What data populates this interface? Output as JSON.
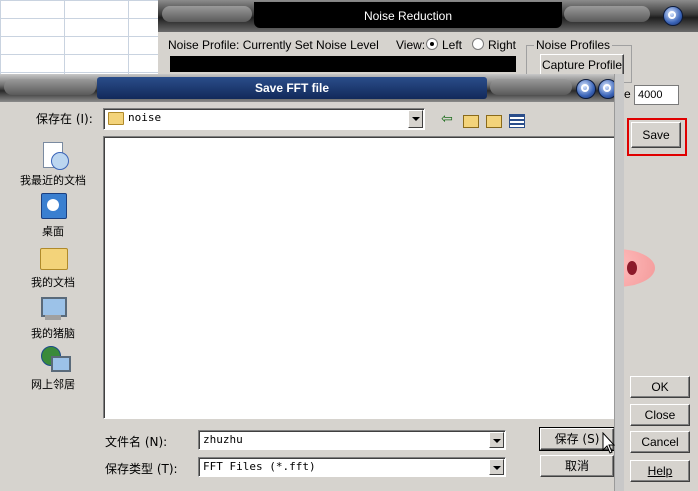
{
  "noise_window": {
    "title": "Noise Reduction",
    "profile_label": "Noise Profile: Currently Set Noise Level",
    "view_label": "View:",
    "view_left": "Left",
    "view_right": "Right",
    "view_selected": "Left",
    "profiles_group": "Noise Profiles",
    "capture_button": "Capture Profile",
    "fft_size_label_tail": "e",
    "fft_size_value": "4000",
    "save_button": "Save",
    "ok_button": "OK",
    "close_button": "Close",
    "cancel_button": "Cancel",
    "help_button": "Help"
  },
  "dialog": {
    "title": "Save FFT file",
    "save_in_label": "保存在 (I):",
    "save_in_value": "noise",
    "places": [
      {
        "label": "我最近的文档",
        "icon": "recent-documents-icon"
      },
      {
        "label": "桌面",
        "icon": "desktop-icon"
      },
      {
        "label": "我的文档",
        "icon": "my-documents-icon"
      },
      {
        "label": "我的猪脑",
        "icon": "my-computer-icon"
      },
      {
        "label": "网上邻居",
        "icon": "network-places-icon"
      }
    ],
    "filename_label": "文件名 (N):",
    "filename_value": "zhuzhu",
    "filetype_label": "保存类型 (T):",
    "filetype_value": "FFT Files (*.fft)",
    "save_button": "保存 (S)",
    "cancel_button": "取消"
  }
}
